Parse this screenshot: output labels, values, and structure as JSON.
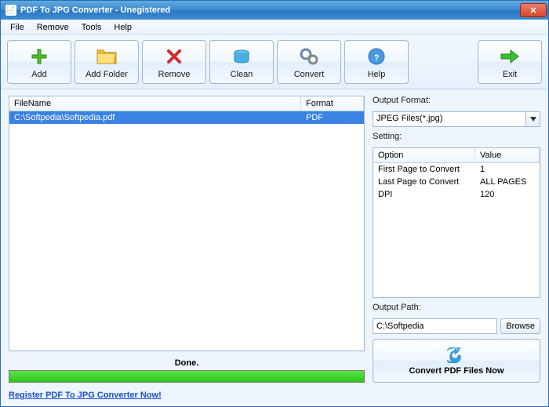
{
  "window": {
    "title": "PDF To JPG Converter - Unegistered"
  },
  "menu": {
    "file": "File",
    "remove": "Remove",
    "tools": "Tools",
    "help": "Help"
  },
  "toolbar": {
    "add": "Add",
    "add_folder": "Add Folder",
    "remove": "Remove",
    "clean": "Clean",
    "convert": "Convert",
    "help": "Help",
    "exit": "Exit"
  },
  "filelist": {
    "col_filename": "FileName",
    "col_format": "Format",
    "rows": [
      {
        "filename": "C:\\Softpedia\\Softpedia.pdf",
        "format": "PDF"
      }
    ]
  },
  "right": {
    "output_format_label": "Output Format:",
    "output_format_value": "JPEG Files(*.jpg)",
    "setting_label": "Setting:",
    "col_option": "Option",
    "col_value": "Value",
    "settings": [
      {
        "option": "First Page to Convert",
        "value": "1"
      },
      {
        "option": "Last Page to Convert",
        "value": "ALL PAGES"
      },
      {
        "option": "DPI",
        "value": "120"
      }
    ],
    "output_path_label": "Output Path:",
    "output_path_value": "C:\\Softpedia",
    "browse": "Browse",
    "convert_now": "Convert PDF Files Now"
  },
  "status": {
    "text": "Done."
  },
  "footer": {
    "register": "Register PDF To JPG Converter Now!"
  }
}
